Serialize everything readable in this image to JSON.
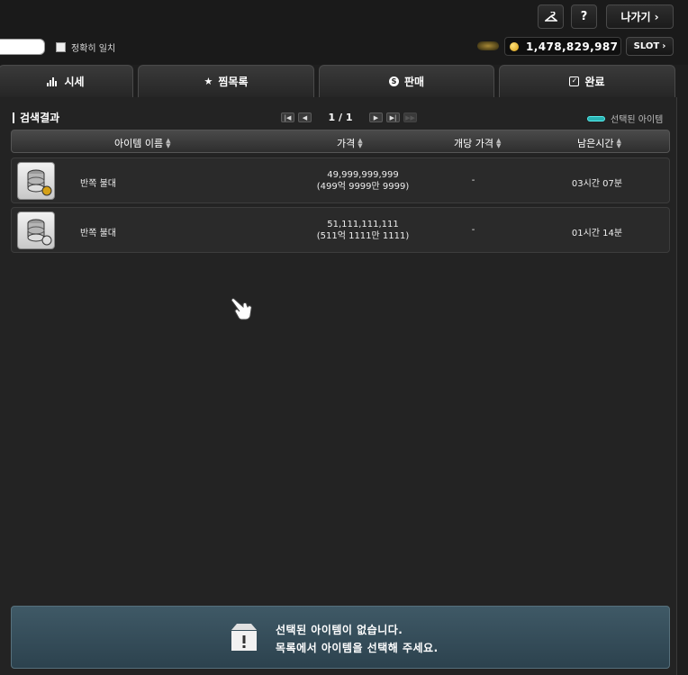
{
  "header": {
    "hanger_icon": "hanger-icon",
    "help_label": "?",
    "exit_label": "나가기",
    "exact_match_label": "정확히 일치",
    "meso_amount": "1,478,829,987",
    "slot_label": "SLOT"
  },
  "tabs": [
    {
      "label": "시세",
      "icon": "bar-chart-icon"
    },
    {
      "label": "찜목록",
      "icon": "star-icon"
    },
    {
      "label": "판매",
      "icon": "s-coin-icon"
    },
    {
      "label": "완료",
      "icon": "check-box-icon"
    }
  ],
  "results": {
    "title": "검색결과",
    "page": "1 / 1",
    "selected_legend": "선택된 아이템",
    "legend_color": "#2ab3b3",
    "columns": [
      "아이템 이름",
      "가격",
      "개당 가격",
      "남은시간"
    ],
    "rows": [
      {
        "name": "반쪽 불대",
        "price": "49,999,999,999",
        "price_korean": "(499억 9999만 9999)",
        "unit_price": "-",
        "time_left": "03시간 07분"
      },
      {
        "name": "반쪽 불대",
        "price": "51,111,111,111",
        "price_korean": "(511억 1111만 1111)",
        "unit_price": "-",
        "time_left": "01시간 14분"
      }
    ]
  },
  "notice": {
    "line1": "선택된 아이템이 없습니다.",
    "line2": "목록에서 아이템을 선택해 주세요."
  }
}
